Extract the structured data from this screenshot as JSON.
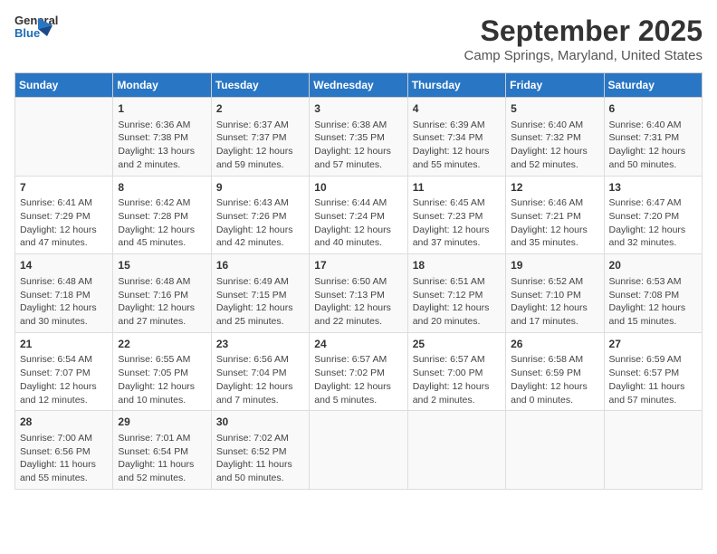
{
  "header": {
    "logo_line1": "General",
    "logo_line2": "Blue",
    "title": "September 2025",
    "subtitle": "Camp Springs, Maryland, United States"
  },
  "calendar": {
    "days_of_week": [
      "Sunday",
      "Monday",
      "Tuesday",
      "Wednesday",
      "Thursday",
      "Friday",
      "Saturday"
    ],
    "weeks": [
      [
        {
          "day": "",
          "info": ""
        },
        {
          "day": "1",
          "info": "Sunrise: 6:36 AM\nSunset: 7:38 PM\nDaylight: 13 hours\nand 2 minutes."
        },
        {
          "day": "2",
          "info": "Sunrise: 6:37 AM\nSunset: 7:37 PM\nDaylight: 12 hours\nand 59 minutes."
        },
        {
          "day": "3",
          "info": "Sunrise: 6:38 AM\nSunset: 7:35 PM\nDaylight: 12 hours\nand 57 minutes."
        },
        {
          "day": "4",
          "info": "Sunrise: 6:39 AM\nSunset: 7:34 PM\nDaylight: 12 hours\nand 55 minutes."
        },
        {
          "day": "5",
          "info": "Sunrise: 6:40 AM\nSunset: 7:32 PM\nDaylight: 12 hours\nand 52 minutes."
        },
        {
          "day": "6",
          "info": "Sunrise: 6:40 AM\nSunset: 7:31 PM\nDaylight: 12 hours\nand 50 minutes."
        }
      ],
      [
        {
          "day": "7",
          "info": "Sunrise: 6:41 AM\nSunset: 7:29 PM\nDaylight: 12 hours\nand 47 minutes."
        },
        {
          "day": "8",
          "info": "Sunrise: 6:42 AM\nSunset: 7:28 PM\nDaylight: 12 hours\nand 45 minutes."
        },
        {
          "day": "9",
          "info": "Sunrise: 6:43 AM\nSunset: 7:26 PM\nDaylight: 12 hours\nand 42 minutes."
        },
        {
          "day": "10",
          "info": "Sunrise: 6:44 AM\nSunset: 7:24 PM\nDaylight: 12 hours\nand 40 minutes."
        },
        {
          "day": "11",
          "info": "Sunrise: 6:45 AM\nSunset: 7:23 PM\nDaylight: 12 hours\nand 37 minutes."
        },
        {
          "day": "12",
          "info": "Sunrise: 6:46 AM\nSunset: 7:21 PM\nDaylight: 12 hours\nand 35 minutes."
        },
        {
          "day": "13",
          "info": "Sunrise: 6:47 AM\nSunset: 7:20 PM\nDaylight: 12 hours\nand 32 minutes."
        }
      ],
      [
        {
          "day": "14",
          "info": "Sunrise: 6:48 AM\nSunset: 7:18 PM\nDaylight: 12 hours\nand 30 minutes."
        },
        {
          "day": "15",
          "info": "Sunrise: 6:48 AM\nSunset: 7:16 PM\nDaylight: 12 hours\nand 27 minutes."
        },
        {
          "day": "16",
          "info": "Sunrise: 6:49 AM\nSunset: 7:15 PM\nDaylight: 12 hours\nand 25 minutes."
        },
        {
          "day": "17",
          "info": "Sunrise: 6:50 AM\nSunset: 7:13 PM\nDaylight: 12 hours\nand 22 minutes."
        },
        {
          "day": "18",
          "info": "Sunrise: 6:51 AM\nSunset: 7:12 PM\nDaylight: 12 hours\nand 20 minutes."
        },
        {
          "day": "19",
          "info": "Sunrise: 6:52 AM\nSunset: 7:10 PM\nDaylight: 12 hours\nand 17 minutes."
        },
        {
          "day": "20",
          "info": "Sunrise: 6:53 AM\nSunset: 7:08 PM\nDaylight: 12 hours\nand 15 minutes."
        }
      ],
      [
        {
          "day": "21",
          "info": "Sunrise: 6:54 AM\nSunset: 7:07 PM\nDaylight: 12 hours\nand 12 minutes."
        },
        {
          "day": "22",
          "info": "Sunrise: 6:55 AM\nSunset: 7:05 PM\nDaylight: 12 hours\nand 10 minutes."
        },
        {
          "day": "23",
          "info": "Sunrise: 6:56 AM\nSunset: 7:04 PM\nDaylight: 12 hours\nand 7 minutes."
        },
        {
          "day": "24",
          "info": "Sunrise: 6:57 AM\nSunset: 7:02 PM\nDaylight: 12 hours\nand 5 minutes."
        },
        {
          "day": "25",
          "info": "Sunrise: 6:57 AM\nSunset: 7:00 PM\nDaylight: 12 hours\nand 2 minutes."
        },
        {
          "day": "26",
          "info": "Sunrise: 6:58 AM\nSunset: 6:59 PM\nDaylight: 12 hours\nand 0 minutes."
        },
        {
          "day": "27",
          "info": "Sunrise: 6:59 AM\nSunset: 6:57 PM\nDaylight: 11 hours\nand 57 minutes."
        }
      ],
      [
        {
          "day": "28",
          "info": "Sunrise: 7:00 AM\nSunset: 6:56 PM\nDaylight: 11 hours\nand 55 minutes."
        },
        {
          "day": "29",
          "info": "Sunrise: 7:01 AM\nSunset: 6:54 PM\nDaylight: 11 hours\nand 52 minutes."
        },
        {
          "day": "30",
          "info": "Sunrise: 7:02 AM\nSunset: 6:52 PM\nDaylight: 11 hours\nand 50 minutes."
        },
        {
          "day": "",
          "info": ""
        },
        {
          "day": "",
          "info": ""
        },
        {
          "day": "",
          "info": ""
        },
        {
          "day": "",
          "info": ""
        }
      ]
    ]
  }
}
